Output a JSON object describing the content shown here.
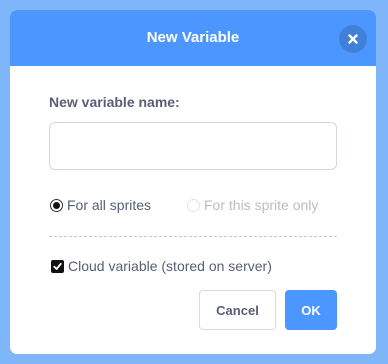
{
  "dialog": {
    "title": "New Variable",
    "close_icon": "close-x-icon"
  },
  "form": {
    "name_label": "New variable name:",
    "name_value": "",
    "name_placeholder": ""
  },
  "scope": {
    "all_sprites_label": "For all sprites",
    "all_sprites_selected": true,
    "this_sprite_label": "For this sprite only",
    "this_sprite_enabled": false
  },
  "cloud": {
    "label": "Cloud variable (stored on server)",
    "checked": true
  },
  "buttons": {
    "cancel_label": "Cancel",
    "ok_label": "OK"
  },
  "colors": {
    "backdrop": "#7fb6f9",
    "accent": "#4c97ff",
    "text": "#575e75",
    "disabled_text": "#b9bdc7"
  }
}
